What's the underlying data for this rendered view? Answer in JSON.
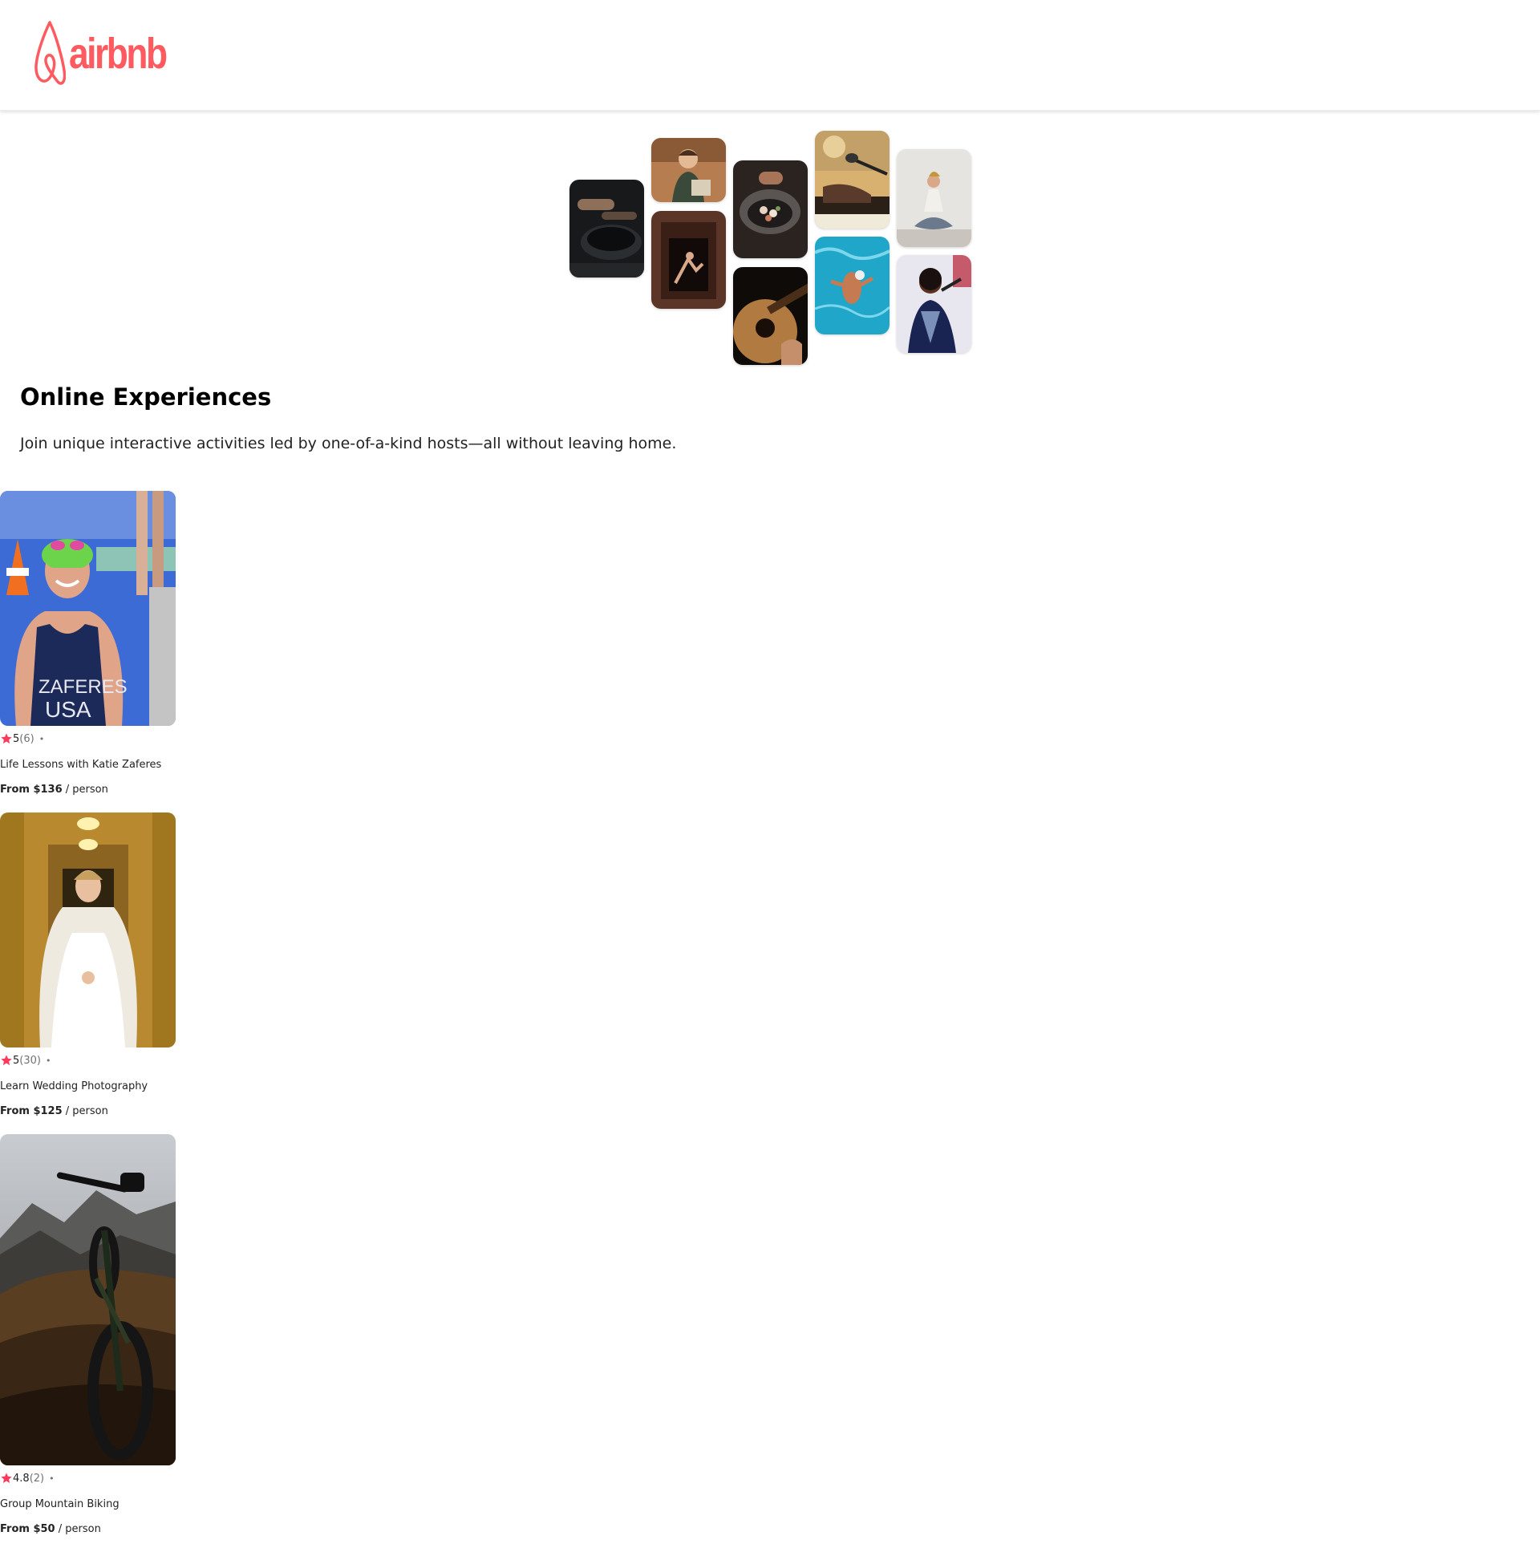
{
  "header": {
    "logo_text": "airbnb",
    "brand_color": "#ff5a5f"
  },
  "hero": {
    "collage_tiles": [
      {
        "subject": "cooking-pans"
      },
      {
        "subject": "woman-with-cookbook"
      },
      {
        "subject": "dancer-in-doorway"
      },
      {
        "subject": "plated-dish"
      },
      {
        "subject": "acoustic-guitar"
      },
      {
        "subject": "piano-and-microphone"
      },
      {
        "subject": "swimmer-in-pool"
      },
      {
        "subject": "meditation"
      },
      {
        "subject": "singer-with-microphone"
      }
    ]
  },
  "intro": {
    "title": "Online Experiences",
    "subtitle": "Join unique interactive activities led by one-of-a-kind hosts—all without leaving home."
  },
  "cards": [
    {
      "rating": "5",
      "reviews": "(6)",
      "separator": "•",
      "name": "Life Lessons with Katie Zaferes",
      "price_prefix": "From $136",
      "price_suffix": " / person",
      "photo": "athlete-portrait"
    },
    {
      "rating": "5",
      "reviews": "(30)",
      "separator": "•",
      "name": "Learn Wedding Photography",
      "price_prefix": "From $125",
      "price_suffix": " / person",
      "photo": "bride-portrait"
    },
    {
      "rating": "4.8",
      "reviews": "(2)",
      "separator": "•",
      "name": "Group Mountain Biking",
      "price_prefix": "From $50",
      "price_suffix": " / person",
      "photo": "mountain-bike"
    }
  ],
  "icons": {
    "star": "star-icon",
    "star_color": "#ff385c"
  }
}
